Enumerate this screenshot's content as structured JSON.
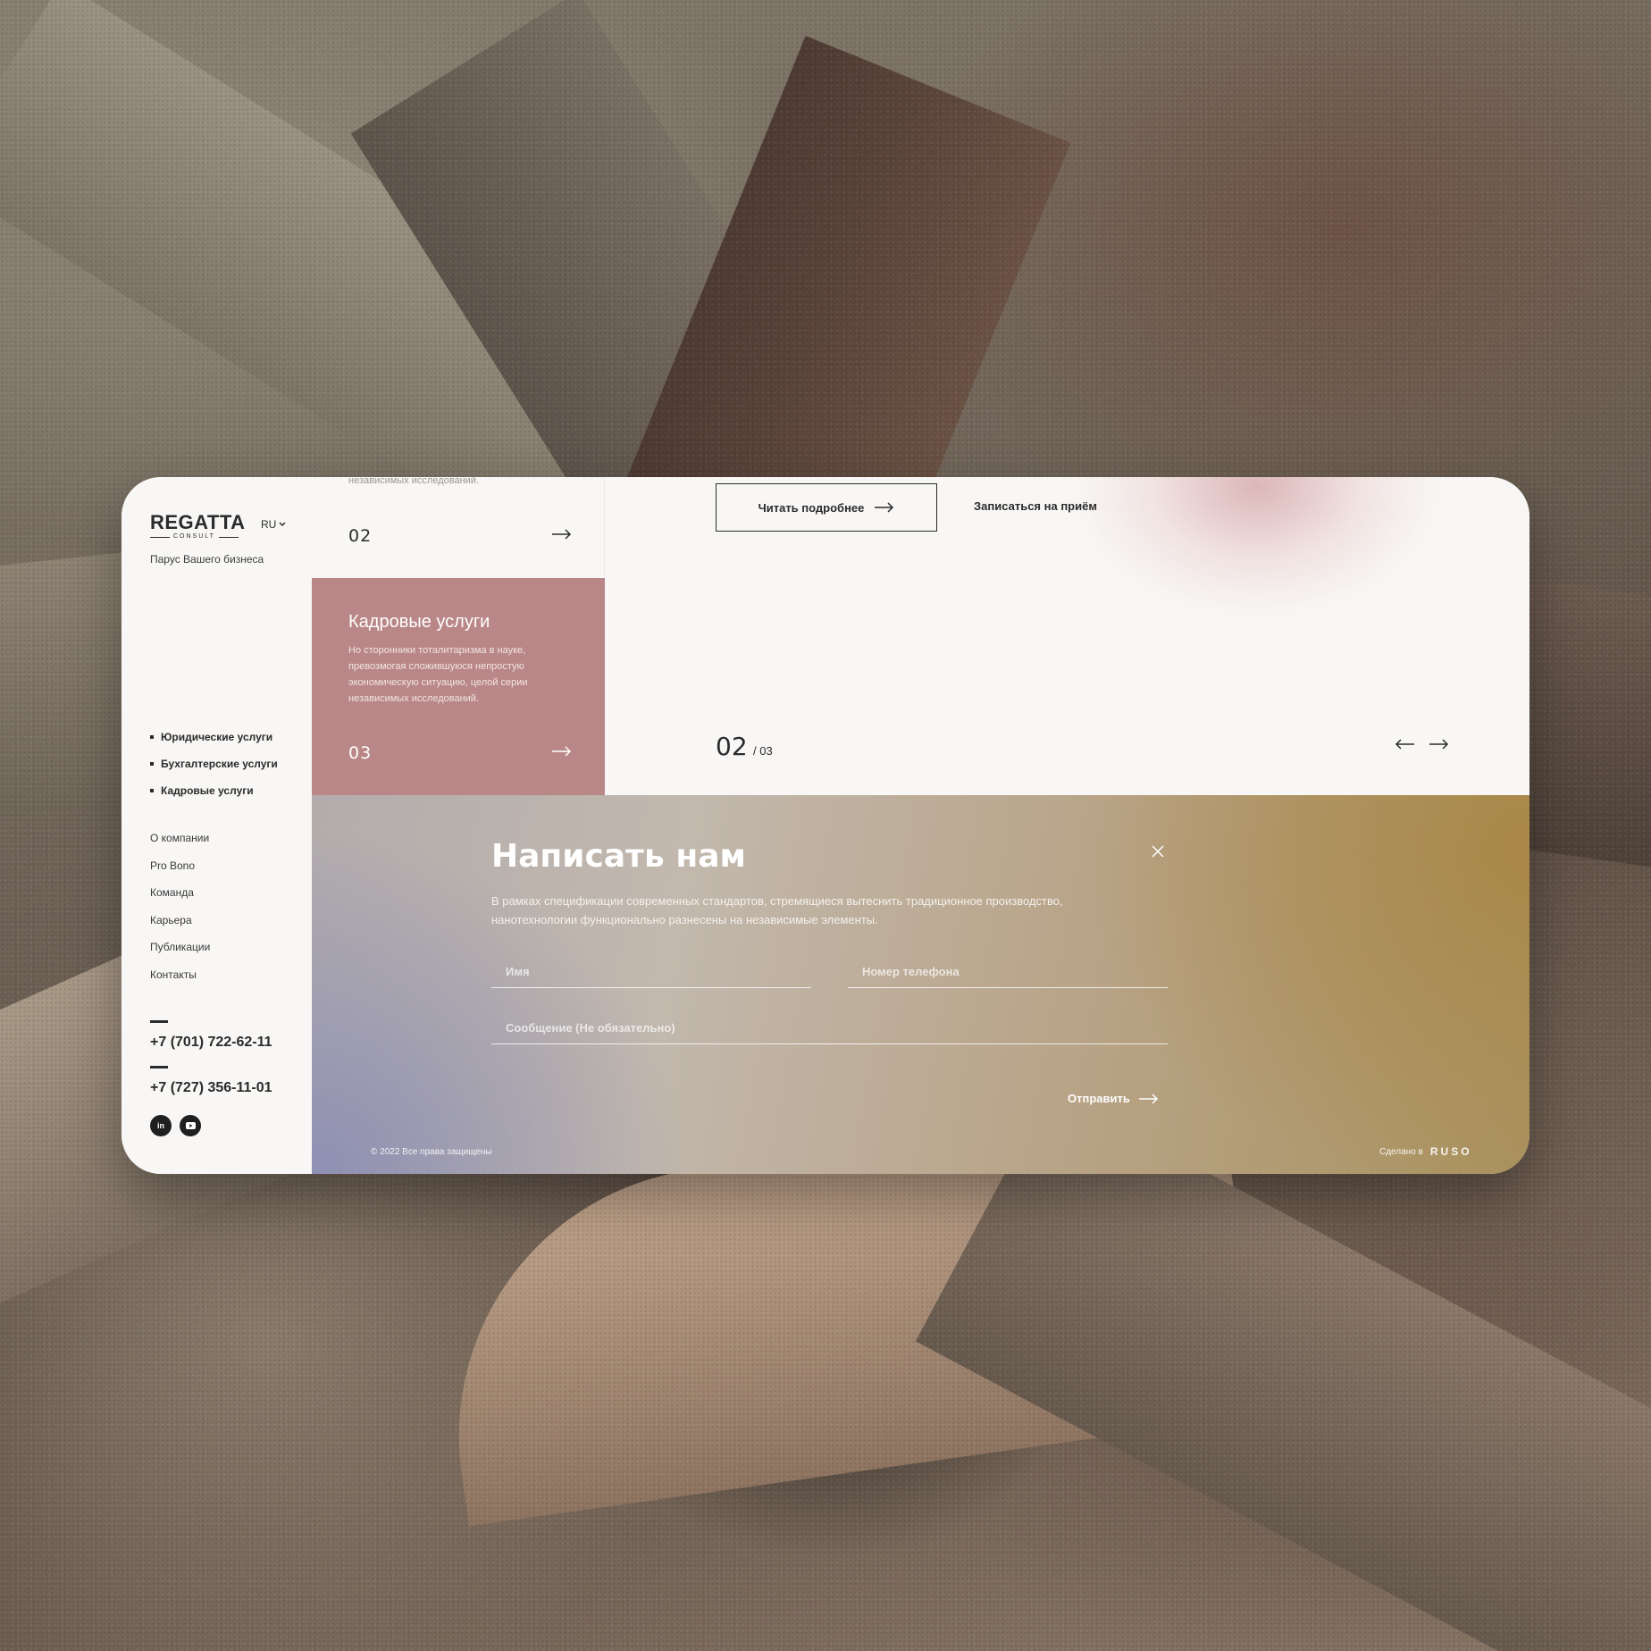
{
  "brand": {
    "logo_main": "REGATTA",
    "logo_sub": "CONSULT",
    "tagline": "Парус Вашего бизнеса",
    "lang": "RU"
  },
  "services_nav": [
    "Юридические услуги",
    "Бухгалтерские услуги",
    "Кадровые услуги"
  ],
  "nav": [
    "О компании",
    "Pro Bono",
    "Команда",
    "Карьера",
    "Публикации",
    "Контакты"
  ],
  "contacts": {
    "phone1": "+7 (701) 722-62-11",
    "phone2": "+7 (727) 356-11-01"
  },
  "social": [
    {
      "icon": "linkedin-icon",
      "label": "in"
    },
    {
      "icon": "youtube-icon",
      "label": "▶"
    }
  ],
  "service_cards": {
    "prev_cut_text": "независимых исследований.",
    "prev_number": "02",
    "active_title": "Кадровые услуги",
    "active_desc": "Но сторонники тоталитаризма в науке, превозмогая сложившуюся непростую экономическую ситуацию, целой серии независимых исследований.",
    "active_number": "03"
  },
  "hero": {
    "read_more": "Читать подробнее",
    "book": "Записаться на приём",
    "slide_current": "02",
    "slide_total": "/ 03"
  },
  "form": {
    "title": "Написать нам",
    "description": "В рамках спецификации современных стандартов, стремящиеся вытеснить традиционное производство, нанотехнологии функционально разнесены на независимые элементы.",
    "name_placeholder": "Имя",
    "phone_placeholder": "Номер телефона",
    "message_placeholder": "Сообщение (Не обязательно)",
    "submit": "Отправить"
  },
  "footer": {
    "copyright": "© 2022 Все права защищены",
    "made_in": "Сделано в",
    "studio": "RUSO"
  },
  "colors": {
    "accent_pink": "#b98787",
    "ink": "#2b2b2b",
    "panel": "#f8f7f5"
  }
}
